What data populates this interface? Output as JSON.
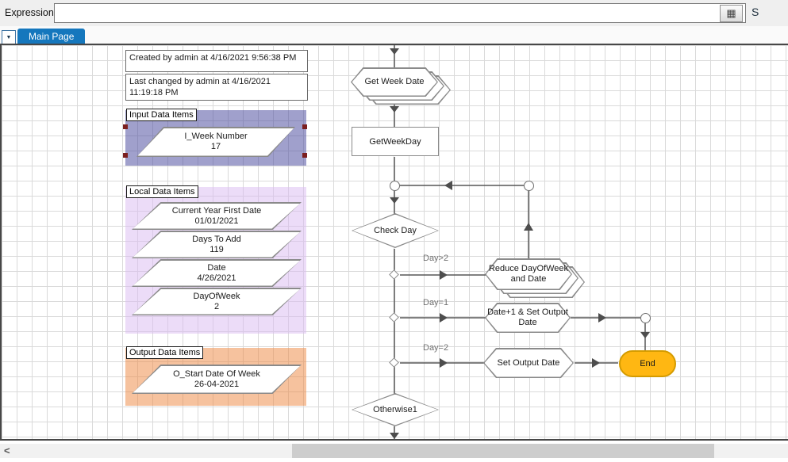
{
  "topbar": {
    "expression_label": "Expression:",
    "expression_value": "",
    "calculator_icon": "▦",
    "partial_right_label": "S"
  },
  "tabs": {
    "dropdown_icon": "▼",
    "items": [
      {
        "label": "Main Page"
      }
    ]
  },
  "notes": [
    {
      "text": "Created by admin at 4/16/2021 9:56:38 PM"
    },
    {
      "text": "Last changed by admin at 4/16/2021 11:19:18 PM"
    }
  ],
  "data_groups": {
    "input": {
      "title": "Input Data Items",
      "items": [
        {
          "name": "I_Week Number",
          "value": "17"
        }
      ]
    },
    "local": {
      "title": "Local Data Items",
      "items": [
        {
          "name": "Current Year First Date",
          "value": "01/01/2021"
        },
        {
          "name": "Days To Add",
          "value": "119"
        },
        {
          "name": "Date",
          "value": "4/26/2021"
        },
        {
          "name": "DayOfWeek",
          "value": "2"
        }
      ]
    },
    "output": {
      "title": "Output Data Items",
      "items": [
        {
          "name": "O_Start Date Of Week",
          "value": "26-04-2021"
        }
      ]
    }
  },
  "flow": {
    "get_week_date": "Get Week Date",
    "get_week_day": "GetWeekDay",
    "check_day": "Check Day",
    "reduce_day": "Reduce DayOfWeek and Date",
    "date_plus_set_output": "Date+1 & Set Output Date",
    "set_output_date": "Set Output Date",
    "end": "End",
    "otherwise": "Otherwise1",
    "branch_labels": [
      "Day>2",
      "Day=1",
      "Day=2"
    ]
  },
  "scrollbar": {
    "left_arrow": "<"
  },
  "colors": {
    "tab_blue": "#1577bd",
    "end_fill": "#ffb712",
    "input_group": "#a0a0cc",
    "local_group": "#ecdcf8",
    "output_group": "#f6c29e",
    "selection_handle": "#7c1f1f",
    "connector": "#565656"
  }
}
